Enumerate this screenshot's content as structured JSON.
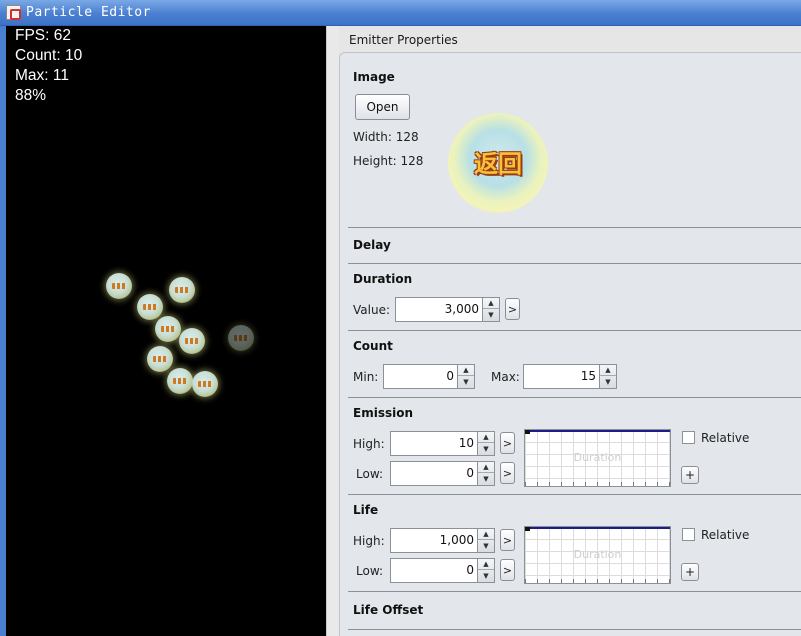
{
  "window": {
    "title": "Particle Editor"
  },
  "preview": {
    "stats": [
      "FPS: 62",
      "Count: 10",
      "Max: 11",
      "88%"
    ]
  },
  "panel": {
    "title": "Emitter Properties"
  },
  "image": {
    "heading": "Image",
    "open_label": "Open",
    "width_text": "Width: 128",
    "height_text": "Height: 128"
  },
  "delay": {
    "heading": "Delay"
  },
  "duration": {
    "heading": "Duration",
    "value_label": "Value:",
    "value": "3,000",
    "expand_label": ">"
  },
  "count": {
    "heading": "Count",
    "min_label": "Min:",
    "min": "0",
    "max_label": "Max:",
    "max": "15"
  },
  "emission": {
    "heading": "Emission",
    "high_label": "High:",
    "high": "10",
    "low_label": "Low:",
    "low": "0",
    "expand_label": ">",
    "graph_caption": "Duration",
    "relative_label": "Relative",
    "relative_checked": false,
    "add_label": "+"
  },
  "life": {
    "heading": "Life",
    "high_label": "High:",
    "high": "1,000",
    "low_label": "Low:",
    "low": "0",
    "expand_label": ">",
    "graph_caption": "Duration",
    "relative_label": "Relative",
    "relative_checked": false,
    "add_label": "+"
  },
  "life_offset": {
    "heading": "Life Offset"
  },
  "icons": {
    "app": "java-cup-icon",
    "spin_up": "spinner-up-icon",
    "spin_down": "spinner-down-icon"
  },
  "colors": {
    "preview_bg": "#000000",
    "panel_bg": "#e3e6ea",
    "titlebar": "#4a7fd0",
    "graph_line": "#1c1c8c"
  }
}
